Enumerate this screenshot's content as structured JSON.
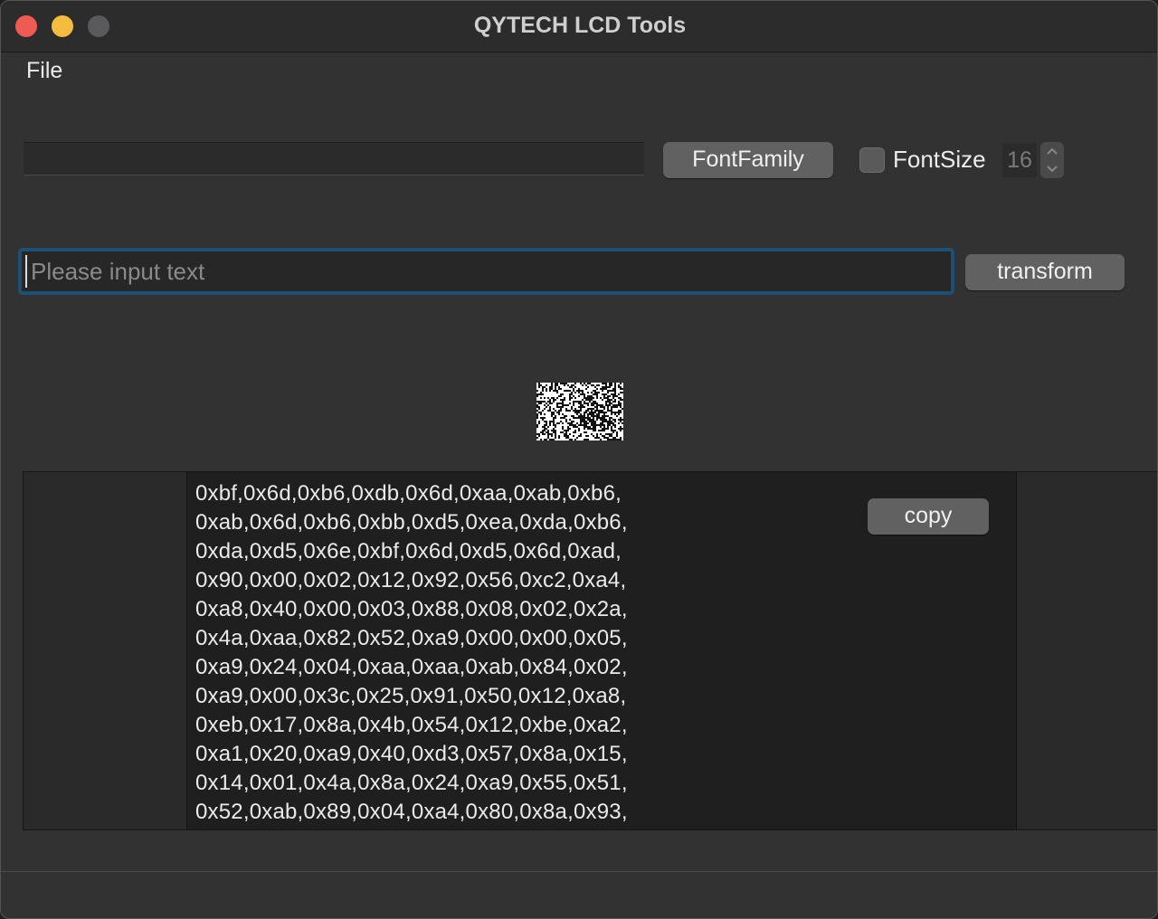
{
  "window": {
    "title": "QYTECH LCD Tools"
  },
  "menu": {
    "file": "File"
  },
  "toolbar": {
    "font_family_value": "",
    "font_family_button": "FontFamily",
    "font_size_label": "FontSize",
    "font_size_checked": false,
    "font_size_value": "16"
  },
  "input": {
    "placeholder": "Please input text",
    "value": ""
  },
  "actions": {
    "transform": "transform",
    "copy": "copy"
  },
  "output": {
    "lines": [
      "0xbf,0x6d,0xb6,0xdb,0x6d,0xaa,0xab,0xb6,",
      "0xab,0x6d,0xb6,0xbb,0xd5,0xea,0xda,0xb6,",
      "0xda,0xd5,0x6e,0xbf,0x6d,0xd5,0x6d,0xad,",
      "0x90,0x00,0x02,0x12,0x92,0x56,0xc2,0xa4,",
      "0xa8,0x40,0x00,0x03,0x88,0x08,0x02,0x2a,",
      "0x4a,0xaa,0x82,0x52,0xa9,0x00,0x00,0x05,",
      "0xa9,0x24,0x04,0xaa,0xaa,0xab,0x84,0x02,",
      "0xa9,0x00,0x3c,0x25,0x91,0x50,0x12,0xa8,",
      "0xeb,0x17,0x8a,0x4b,0x54,0x12,0xbe,0xa2,",
      "0xa1,0x20,0xa9,0x40,0xd3,0x57,0x8a,0x15,",
      "0x14,0x01,0x4a,0x8a,0x24,0xa9,0x55,0x51,",
      "0x52,0xab,0x89,0x04,0xa4,0x80,0x8a,0x93,"
    ]
  },
  "colors": {
    "window_bg": "#323232",
    "button_bg": "#616161",
    "focus_ring": "#1e4f74",
    "close": "#ee5b52",
    "minimize": "#f5bd3f",
    "maximize": "#5a5a5c"
  }
}
